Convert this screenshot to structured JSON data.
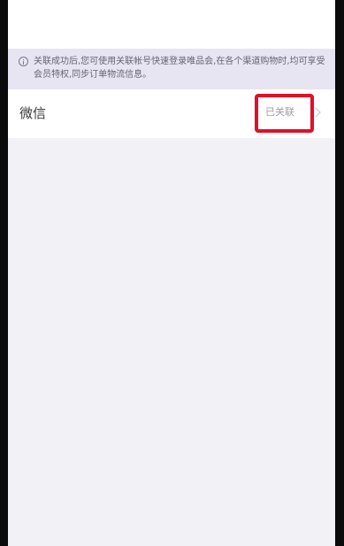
{
  "notice": {
    "text": "关联成功后,您可使用关联帐号快速登录唯品会,在各个渠道购物时,均可享受会员特权,同步订单物流信息。",
    "icon": "info-icon"
  },
  "linked_account": {
    "name": "微信",
    "status": "已关联",
    "chevron_icon": "chevron-right-icon",
    "highlight_color": "#e00f2a"
  }
}
